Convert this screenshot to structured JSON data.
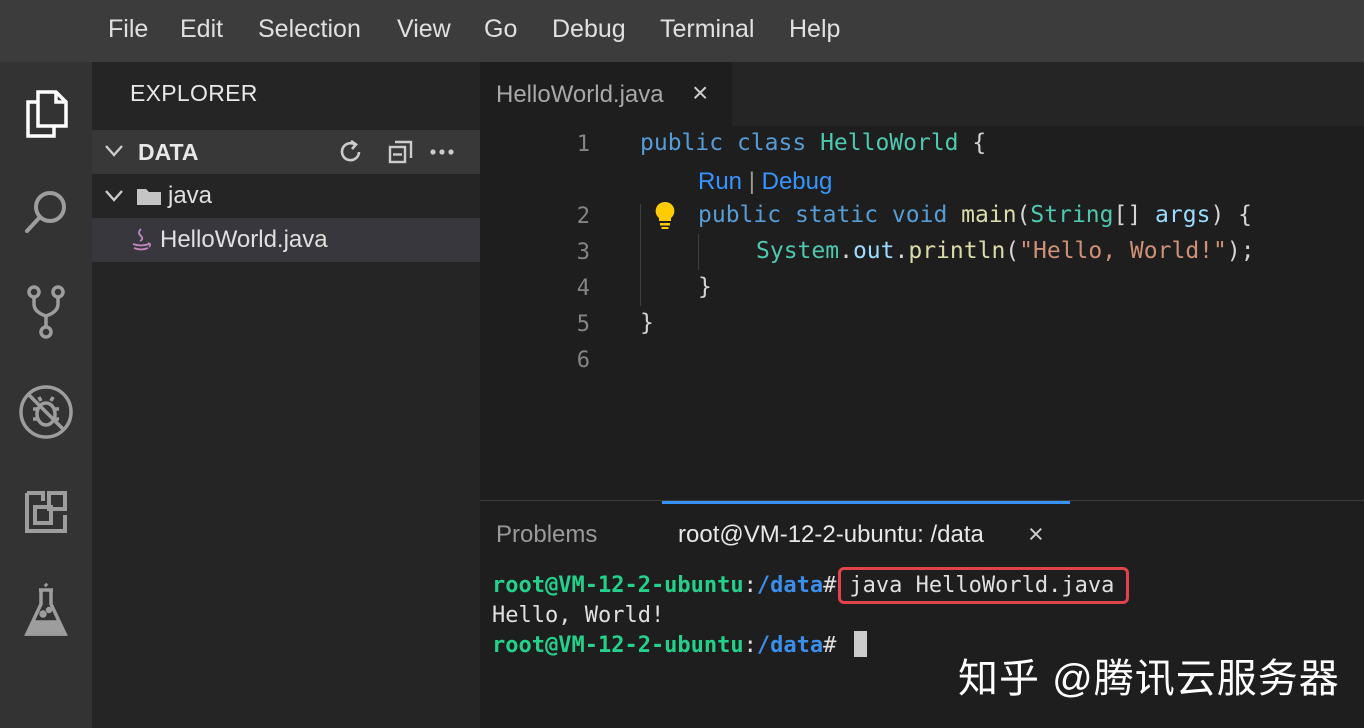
{
  "menu": [
    "File",
    "Edit",
    "Selection",
    "View",
    "Go",
    "Debug",
    "Terminal",
    "Help"
  ],
  "activity_bar": [
    "explorer-icon",
    "search-icon",
    "source-control-icon",
    "debug-icon",
    "extensions-icon",
    "test-flask-icon"
  ],
  "explorer": {
    "title": "EXPLORER",
    "section": "DATA",
    "section_actions": [
      "refresh-icon",
      "collapse-all-icon",
      "more-icon"
    ],
    "tree": [
      {
        "label": "java",
        "type": "folder",
        "expanded": true
      },
      {
        "label": "HelloWorld.java",
        "type": "java-file",
        "selected": true
      }
    ]
  },
  "editor": {
    "tab": {
      "label": "HelloWorld.java",
      "close": "×"
    },
    "line_numbers": [
      "1",
      "2",
      "3",
      "4",
      "5",
      "6"
    ],
    "code_lens": {
      "run": "Run",
      "separator": "|",
      "debug": "Debug"
    },
    "code": {
      "l1": {
        "kw1": "public",
        "kw2": "class",
        "cls": "HelloWorld",
        "rest": " {"
      },
      "l2": {
        "kw1": "public",
        "kw2": "static",
        "kw3": "void",
        "fn": "main",
        "p1": "(",
        "type": "String",
        "p2": "[] ",
        "param": "args",
        "rest": ") {"
      },
      "l3": {
        "cls": "System",
        "dot1": ".",
        "field": "out",
        "dot2": ".",
        "fn": "println",
        "p1": "(",
        "str": "\"Hello, World!\"",
        "rest": ");"
      },
      "l4": "}",
      "l5": "}"
    }
  },
  "panel": {
    "tabs": {
      "problems": "Problems",
      "terminal": "root@VM-12-2-ubuntu: /data",
      "close": "×"
    },
    "terminal": {
      "user": "root@VM-12-2-ubuntu",
      "colon": ":",
      "path": "/data",
      "prompt": "#",
      "command": "java HelloWorld.java",
      "output": "Hello, World!"
    }
  },
  "watermark": "知乎 @腾讯云服务器",
  "colors": {
    "accent": "#3794ff",
    "terminal_user": "#23d18b",
    "terminal_path": "#3b8eea",
    "highlight_box": "#e0444a",
    "bulb": "#ffcc00"
  }
}
